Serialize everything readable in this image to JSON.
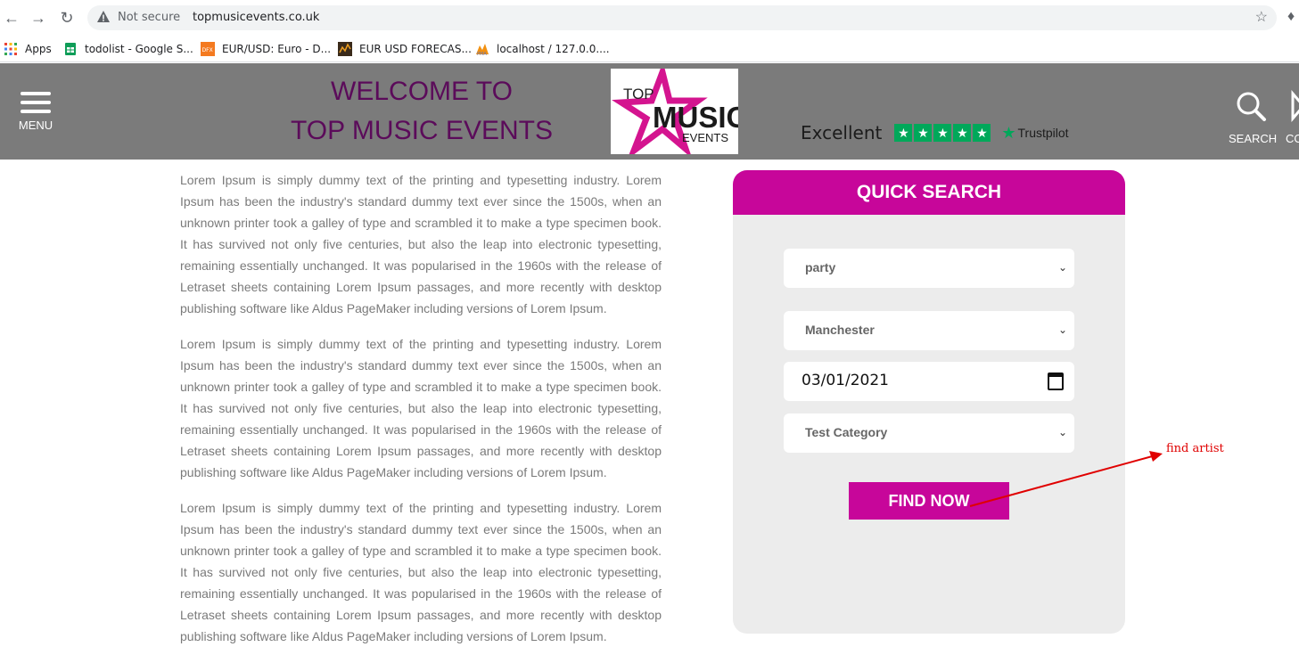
{
  "browser": {
    "security_label": "Not secure",
    "url": "topmusicevents.co.uk",
    "bookmarks": [
      {
        "label": "Apps",
        "icon": "apps-grid-icon"
      },
      {
        "label": "todolist - Google S...",
        "icon": "google-sheets-icon"
      },
      {
        "label": "EUR/USD: Euro - D...",
        "icon": "dfx-icon"
      },
      {
        "label": "EUR USD FORECAS...",
        "icon": "chart-icon"
      },
      {
        "label": "localhost / 127.0.0....",
        "icon": "phpmyadmin-icon"
      }
    ]
  },
  "header": {
    "menu_label": "MENU",
    "welcome_line1": "WELCOME TO",
    "welcome_line2": "TOP MUSIC EVENTS",
    "logo": {
      "top": "TOP",
      "music": "MUSIC",
      "events": "EVENTS"
    },
    "trustpilot": {
      "rating_word": "Excellent",
      "brand": "Trustpilot",
      "stars": 5
    },
    "search_label": "SEARCH",
    "cut_label": "CO",
    "colors": {
      "header_bg": "#7b7b7b",
      "welcome": "#5b0b5a",
      "accent": "#c7069a",
      "trustpilot_green": "#00a85a"
    }
  },
  "content": {
    "paragraphs": [
      "Lorem Ipsum is simply dummy text of the printing and typesetting industry. Lorem Ipsum has been the industry's standard dummy text ever since the 1500s, when an unknown printer took a galley of type and scrambled it to make a type specimen book. It has survived not only five centuries, but also the leap into electronic typesetting, remaining essentially unchanged. It was popularised in the 1960s with the release of Letraset sheets containing Lorem Ipsum passages, and more recently with desktop publishing software like Aldus PageMaker including versions of Lorem Ipsum.",
      "Lorem Ipsum is simply dummy text of the printing and typesetting industry. Lorem Ipsum has been the industry's standard dummy text ever since the 1500s, when an unknown printer took a galley of type and scrambled it to make a type specimen book. It has survived not only five centuries, but also the leap into electronic typesetting, remaining essentially unchanged. It was popularised in the 1960s with the release of Letraset sheets containing Lorem Ipsum passages, and more recently with desktop publishing software like Aldus PageMaker including versions of Lorem Ipsum.",
      "Lorem Ipsum is simply dummy text of the printing and typesetting industry. Lorem Ipsum has been the industry's standard dummy text ever since the 1500s, when an unknown printer took a galley of type and scrambled it to make a type specimen book. It has survived not only five centuries, but also the leap into electronic typesetting, remaining essentially unchanged. It was popularised in the 1960s with the release of Letraset sheets containing Lorem Ipsum passages, and more recently with desktop publishing software like Aldus PageMaker including versions of Lorem Ipsum."
    ]
  },
  "quick_search": {
    "title": "QUICK SEARCH",
    "event_type": "party",
    "location": "Manchester",
    "date": "03/01/2021",
    "category": "Test Category",
    "button_label": "FIND NOW"
  },
  "annotation": {
    "text": "find artist",
    "color": "#e00000"
  }
}
